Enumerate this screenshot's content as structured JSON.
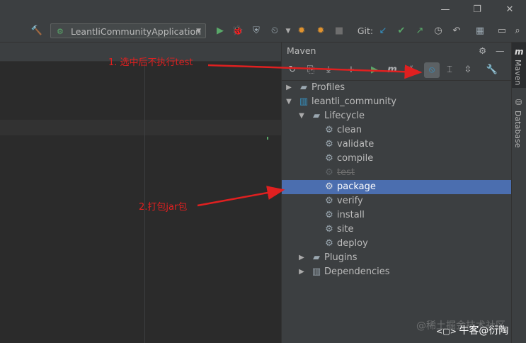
{
  "toolbar": {
    "run_config": "LeantliCommunityApplication",
    "git_label": "Git:"
  },
  "maven_panel": {
    "title": "Maven"
  },
  "tree": {
    "profiles": "Profiles",
    "project": "leantli_community",
    "lifecycle": "Lifecycle",
    "goals": [
      "clean",
      "validate",
      "compile",
      "test",
      "package",
      "verify",
      "install",
      "site",
      "deploy"
    ],
    "plugins": "Plugins",
    "dependencies": "Dependencies"
  },
  "side_tabs": {
    "maven": "Maven",
    "database": "Database"
  },
  "annotations": {
    "step1": "1. 选中后不执行test",
    "step2": "2.打包jar包"
  },
  "watermark": {
    "juejin": "@稀土掘金技术社区",
    "nowcoder": "牛客@衍陶"
  },
  "colors": {
    "selection": "#4b6eaf",
    "annotation": "#e02020",
    "run_green": "#59a869"
  }
}
